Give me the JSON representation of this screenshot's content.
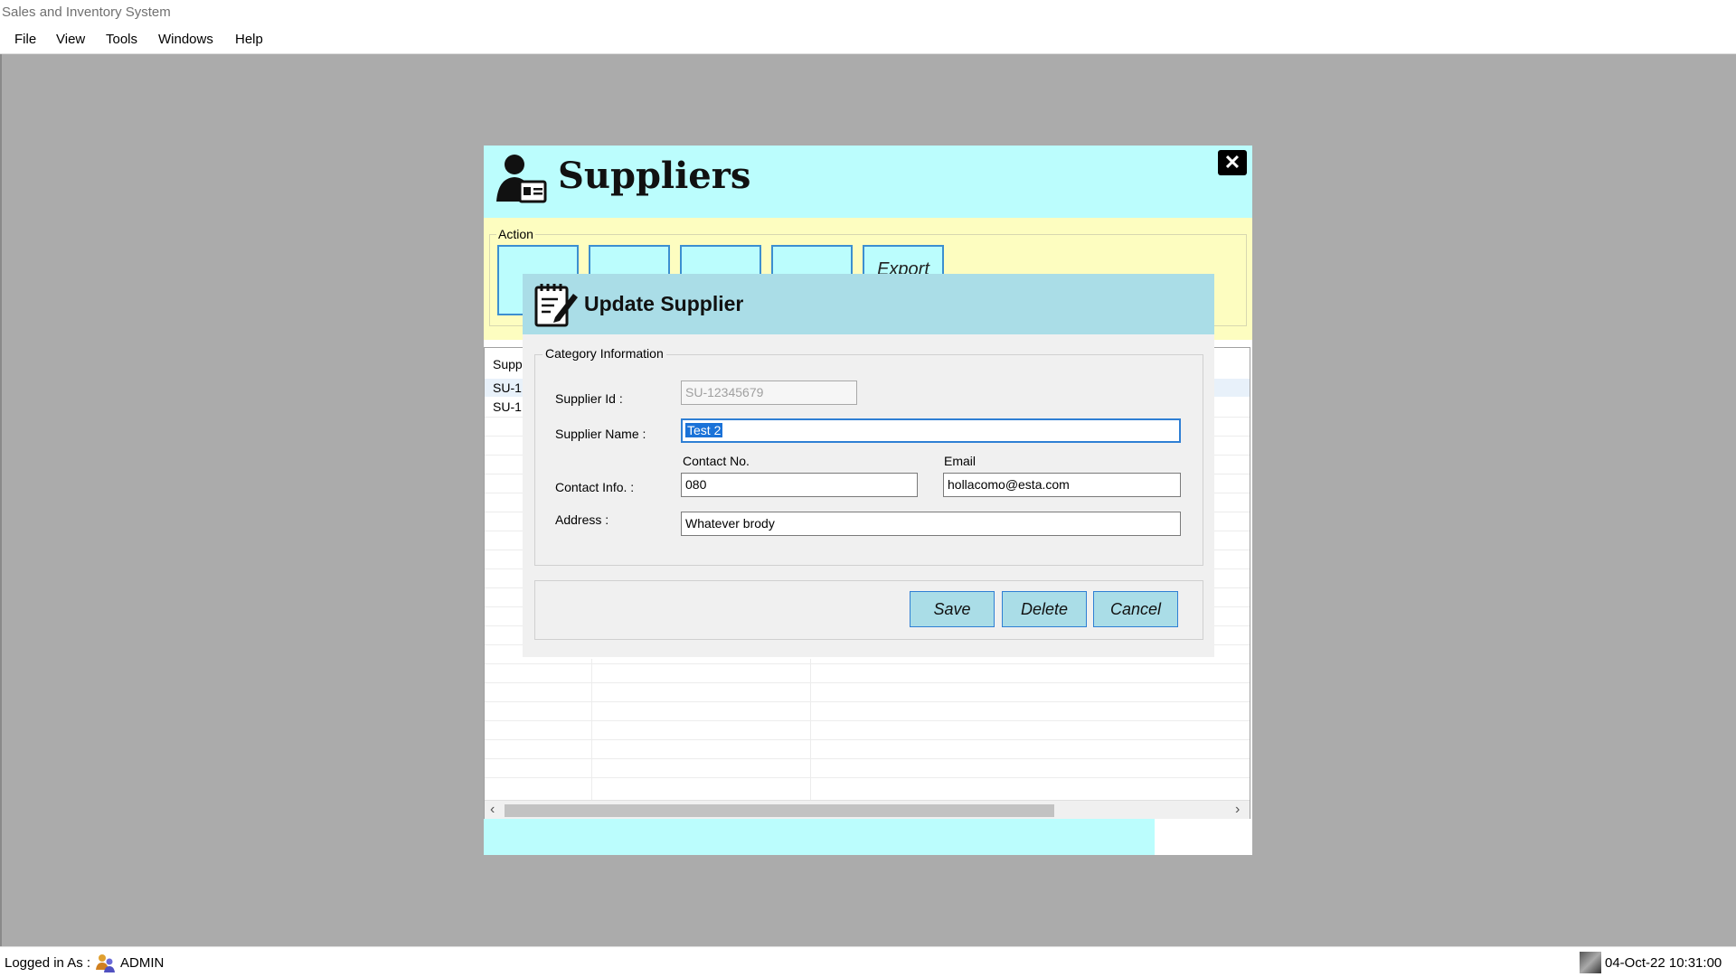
{
  "app": {
    "title": "Sales and Inventory System"
  },
  "menu": {
    "items": [
      "File",
      "View",
      "Tools",
      "Windows",
      "Help"
    ]
  },
  "suppliers_window": {
    "title": "Suppliers",
    "close_glyph": "✕",
    "action_group_label": "Action",
    "action_buttons": [
      "",
      "",
      "",
      "",
      "Export"
    ],
    "grid_header_partial": "Supp",
    "grid_rows_partial": [
      "SU-1:",
      "SU-1:"
    ]
  },
  "dialog": {
    "title": "Update Supplier",
    "group_label": "Category Information",
    "supplier_id": {
      "label": "Supplier Id :",
      "value": "SU-12345679"
    },
    "supplier_name": {
      "label": "Supplier Name :",
      "value": "Test 2"
    },
    "contact_info": {
      "label": "Contact Info. :",
      "contact_no_label": "Contact No.",
      "contact_no_value": "080",
      "email_label": "Email",
      "email_value": "hollacomo@esta.com"
    },
    "address": {
      "label": "Address :",
      "value": "Whatever brody"
    },
    "buttons": {
      "save": "Save",
      "delete": "Delete",
      "cancel": "Cancel"
    }
  },
  "status": {
    "logged_in_label": "Logged in As :",
    "user": "ADMIN",
    "datetime": "04-Oct-22 10:31:00"
  },
  "colors": {
    "header_cyan": "#bbfdfd",
    "action_yellow": "#fdfdc0",
    "dialog_header": "#aadde7",
    "accent_blue": "#2f7fd4",
    "mdi_gray": "#ababab"
  },
  "icons": {
    "suppliers": "person-card-icon",
    "dialog": "notepad-pen-icon",
    "user": "user-group-icon",
    "clock": "clock-image-icon"
  }
}
